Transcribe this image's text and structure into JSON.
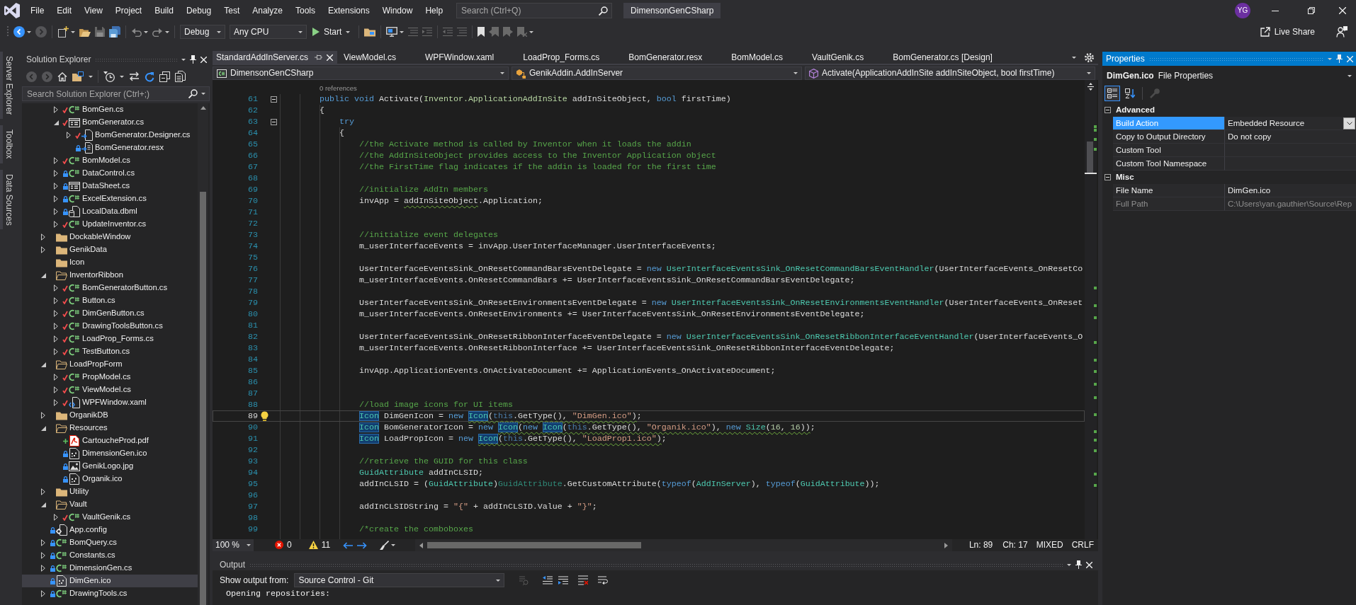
{
  "title_bar": {
    "menu": [
      "File",
      "Edit",
      "View",
      "Project",
      "Build",
      "Debug",
      "Test",
      "Analyze",
      "Tools",
      "Extensions",
      "Window",
      "Help"
    ],
    "search": {
      "placeholder": "Search (Ctrl+Q)"
    },
    "solution_name": "DimensonGenCSharp",
    "user_initials": "YG"
  },
  "toolbar": {
    "configuration": "Debug",
    "platform": "Any CPU",
    "start": "Start",
    "live_share": "Live Share"
  },
  "side_tabs": [
    "Server Explorer",
    "Toolbox",
    "Data Sources"
  ],
  "solution_explorer": {
    "title": "Solution Explorer",
    "search": {
      "placeholder": "Search Solution Explorer (Ctrl+;)"
    },
    "items": [
      {
        "children": [
          {
            "label": "BomGen.cs",
            "kind": "csharp",
            "checked_out": true,
            "locked": false,
            "added": false,
            "expanded": false,
            "selected": false
          },
          {
            "label": "BomGenerator.cs",
            "kind": "form",
            "checked_out": true,
            "locked": false,
            "added": false,
            "expanded": true,
            "selected": false,
            "children": [
              {
                "label": "BomGenerator.Designer.cs",
                "kind": "designer",
                "checked_out": true,
                "locked": false,
                "added": false,
                "expanded": false,
                "selected": false
              },
              {
                "label": "BomGenerator.resx",
                "kind": "resource",
                "checked_out": false,
                "locked": true,
                "added": false,
                "selected": false
              }
            ]
          },
          {
            "label": "BomModel.cs",
            "kind": "csharp",
            "checked_out": true,
            "locked": false,
            "added": false,
            "expanded": false,
            "selected": false
          },
          {
            "label": "DataControl.cs",
            "kind": "csharp",
            "checked_out": false,
            "locked": true,
            "added": false,
            "expanded": false,
            "selected": false
          },
          {
            "label": "DataSheet.cs",
            "kind": "form",
            "checked_out": false,
            "locked": true,
            "added": false,
            "expanded": false,
            "selected": false
          },
          {
            "label": "ExcelExtension.cs",
            "kind": "csharp",
            "checked_out": false,
            "locked": true,
            "added": false,
            "expanded": false,
            "selected": false
          },
          {
            "label": "LocalData.dbml",
            "kind": "database",
            "checked_out": false,
            "locked": true,
            "added": false,
            "expanded": false,
            "selected": false
          },
          {
            "label": "UpdateInventor.cs",
            "kind": "csharp",
            "checked_out": true,
            "locked": false,
            "added": false,
            "expanded": false,
            "selected": false
          }
        ]
      },
      {
        "label": "DockableWindow",
        "kind": "folder",
        "expanded": false,
        "selected": false
      },
      {
        "label": "GenikData",
        "kind": "folder",
        "expanded": false,
        "selected": false
      },
      {
        "label": "Icon",
        "kind": "folder",
        "selected": false
      },
      {
        "label": "InventorRibbon",
        "kind": "folder",
        "expanded": true,
        "selected": false,
        "children": [
          {
            "label": "BomGeneratorButton.cs",
            "kind": "csharp",
            "checked_out": true,
            "locked": false,
            "added": false,
            "expanded": false,
            "selected": false
          },
          {
            "label": "Button.cs",
            "kind": "csharp",
            "checked_out": true,
            "locked": false,
            "added": false,
            "expanded": false,
            "selected": false
          },
          {
            "label": "DimGenButton.cs",
            "kind": "csharp",
            "checked_out": true,
            "locked": false,
            "added": false,
            "expanded": false,
            "selected": false
          },
          {
            "label": "DrawingToolsButton.cs",
            "kind": "csharp",
            "checked_out": true,
            "locked": false,
            "added": false,
            "expanded": false,
            "selected": false
          },
          {
            "label": "LoadProp_Forms.cs",
            "kind": "csharp",
            "checked_out": true,
            "locked": false,
            "added": false,
            "expanded": false,
            "selected": false
          },
          {
            "label": "TestButton.cs",
            "kind": "csharp",
            "checked_out": true,
            "locked": false,
            "added": false,
            "expanded": false,
            "selected": false
          }
        ]
      },
      {
        "label": "LoadPropForm",
        "kind": "folder",
        "expanded": true,
        "selected": false,
        "children": [
          {
            "label": "PropModel.cs",
            "kind": "csharp",
            "checked_out": true,
            "locked": false,
            "added": false,
            "expanded": false,
            "selected": false
          },
          {
            "label": "ViewModel.cs",
            "kind": "csharp",
            "checked_out": true,
            "locked": false,
            "added": false,
            "expanded": false,
            "selected": false
          },
          {
            "label": "WPFWindow.xaml",
            "kind": "xaml",
            "checked_out": true,
            "locked": false,
            "added": false,
            "expanded": false,
            "selected": false
          }
        ]
      },
      {
        "label": "OrganikDB",
        "kind": "folder",
        "expanded": false,
        "selected": false
      },
      {
        "label": "Resources",
        "kind": "folder",
        "expanded": true,
        "selected": false,
        "children": [
          {
            "label": "CartoucheProd.pdf",
            "kind": "pdf",
            "checked_out": false,
            "locked": false,
            "added": true,
            "selected": false
          },
          {
            "label": "DimensionGen.ico",
            "kind": "icon-file",
            "checked_out": false,
            "locked": true,
            "added": false,
            "selected": false
          },
          {
            "label": "GenikLogo.jpg",
            "kind": "image",
            "checked_out": false,
            "locked": true,
            "added": false,
            "selected": false
          },
          {
            "label": "Organik.ico",
            "kind": "icon-file",
            "checked_out": false,
            "locked": true,
            "added": false,
            "selected": false
          }
        ]
      },
      {
        "label": "Utility",
        "kind": "folder",
        "expanded": false,
        "selected": false
      },
      {
        "label": "Vault",
        "kind": "folder",
        "expanded": true,
        "selected": false,
        "children": [
          {
            "label": "VaultGenik.cs",
            "kind": "csharp",
            "checked_out": true,
            "locked": false,
            "added": false,
            "expanded": false,
            "selected": false
          }
        ]
      },
      {
        "label": "App.config",
        "kind": "config",
        "checked_out": false,
        "locked": true,
        "added": false,
        "selected": false
      },
      {
        "label": "BomQuery.cs",
        "kind": "csharp",
        "checked_out": false,
        "locked": true,
        "added": false,
        "expanded": false,
        "selected": false
      },
      {
        "label": "Constants.cs",
        "kind": "csharp",
        "checked_out": false,
        "locked": true,
        "added": false,
        "expanded": false,
        "selected": false
      },
      {
        "label": "DimensionGen.cs",
        "kind": "csharp",
        "checked_out": false,
        "locked": true,
        "added": false,
        "expanded": false,
        "selected": false
      },
      {
        "label": "DimGen.ico",
        "kind": "icon-file",
        "checked_out": false,
        "locked": true,
        "added": false,
        "selected": true
      },
      {
        "label": "DrawingTools.cs",
        "kind": "csharp",
        "checked_out": false,
        "locked": true,
        "added": false,
        "expanded": false,
        "selected": false
      }
    ]
  },
  "editor": {
    "tabs": [
      {
        "label": "StandardAddInServer.cs",
        "selected": true
      },
      {
        "label": "ViewModel.cs",
        "selected": false
      },
      {
        "label": "WPFWindow.xaml",
        "selected": false
      },
      {
        "label": "LoadProp_Forms.cs",
        "selected": false
      },
      {
        "label": "BomGenerator.resx",
        "selected": false
      },
      {
        "label": "BomModel.cs",
        "selected": false
      },
      {
        "label": "VaultGenik.cs",
        "selected": false
      },
      {
        "label": "BomGenerator.cs [Design]",
        "selected": false
      }
    ],
    "navigation": [
      {
        "kind": "project",
        "label": "DimensonGenCSharp"
      },
      {
        "kind": "class",
        "label": "GenikAddin.AddInServer"
      },
      {
        "kind": "method",
        "label": "Activate(ApplicationAddInSite addInSiteObject, bool firstTime)"
      }
    ],
    "lines": [
      {
        "number": "61",
        "codelens": "0 references",
        "folded": false,
        "tokens": [
          {
            "text": "        public void",
            "kind": "keyword"
          },
          {
            "text": " Activate(",
            "kind": "plain"
          },
          {
            "text": "Inventor.ApplicationAddInSite",
            "kind": "interface"
          },
          {
            "text": " addInSiteObject, ",
            "kind": "plain"
          },
          {
            "text": "bool",
            "kind": "keyword"
          },
          {
            "text": " firstTime)",
            "kind": "plain"
          }
        ]
      },
      {
        "number": "62",
        "tokens": [
          {
            "text": "        {",
            "kind": "plain"
          }
        ]
      },
      {
        "number": "63",
        "folded": false,
        "tokens": [
          {
            "text": "            try",
            "kind": "keyword"
          }
        ]
      },
      {
        "number": "64",
        "tokens": [
          {
            "text": "            {",
            "kind": "plain"
          }
        ]
      },
      {
        "number": "65",
        "tokens": [
          {
            "text": "                //the Activate method is called by Inventor when it loads the addin",
            "kind": "comment"
          }
        ]
      },
      {
        "number": "66",
        "tokens": [
          {
            "text": "                //the AddInSiteObject provides access to the Inventor Application object",
            "kind": "comment"
          }
        ]
      },
      {
        "number": "67",
        "tokens": [
          {
            "text": "                //the FirstTime flag indicates if the addin is loaded for the first time",
            "kind": "comment"
          }
        ]
      },
      {
        "number": "68"
      },
      {
        "number": "69",
        "tokens": [
          {
            "text": "                //initialize AddIn members",
            "kind": "comment"
          }
        ]
      },
      {
        "number": "70",
        "tokens": [
          {
            "text": "                invApp = ",
            "kind": "plain"
          },
          {
            "text": "addInSiteObject",
            "kind": "plain",
            "squiggle": true
          },
          {
            "text": ".Application;",
            "kind": "plain"
          }
        ]
      },
      {
        "number": "71"
      },
      {
        "number": "72"
      },
      {
        "number": "73",
        "tokens": [
          {
            "text": "                //initialize event delegates",
            "kind": "comment"
          }
        ]
      },
      {
        "number": "74",
        "tokens": [
          {
            "text": "                m_userInterfaceEvents = invApp.UserInterfaceManager.UserInterfaceEvents;",
            "kind": "plain"
          }
        ]
      },
      {
        "number": "75"
      },
      {
        "number": "76",
        "tokens": [
          {
            "text": "                UserInterfaceEventsSink_OnResetCommandBarsEventDelegate = ",
            "kind": "plain"
          },
          {
            "text": "new",
            "kind": "keyword"
          },
          {
            "text": " UserInterfaceEventsSink_OnResetCommandBarsEventHandler",
            "kind": "type"
          },
          {
            "text": "(UserInterfaceEvents_OnResetCo",
            "kind": "plain"
          }
        ]
      },
      {
        "number": "77",
        "tokens": [
          {
            "text": "                m_userInterfaceEvents.OnResetCommandBars += UserInterfaceEventsSink_OnResetCommandBarsEventDelegate;",
            "kind": "plain"
          }
        ]
      },
      {
        "number": "78"
      },
      {
        "number": "79",
        "tokens": [
          {
            "text": "                UserInterfaceEventsSink_OnResetEnvironmentsEventDelegate = ",
            "kind": "plain"
          },
          {
            "text": "new",
            "kind": "keyword"
          },
          {
            "text": " UserInterfaceEventsSink_OnResetEnvironmentsEventHandler",
            "kind": "type"
          },
          {
            "text": "(UserInterfaceEvents_OnReset",
            "kind": "plain"
          }
        ]
      },
      {
        "number": "80",
        "tokens": [
          {
            "text": "                m_userInterfaceEvents.OnResetEnvironments += UserInterfaceEventsSink_OnResetEnvironmentsEventDelegate;",
            "kind": "plain"
          }
        ]
      },
      {
        "number": "81"
      },
      {
        "number": "82",
        "tokens": [
          {
            "text": "                UserInterfaceEventsSink_OnResetRibbonInterfaceEventDelegate = ",
            "kind": "plain"
          },
          {
            "text": "new",
            "kind": "keyword"
          },
          {
            "text": " UserInterfaceEventsSink_OnResetRibbonInterfaceEventHandler",
            "kind": "type"
          },
          {
            "text": "(UserInterfaceEvents_O",
            "kind": "plain"
          }
        ]
      },
      {
        "number": "83",
        "tokens": [
          {
            "text": "                m_userInterfaceEvents.OnResetRibbonInterface += UserInterfaceEventsSink_OnResetRibbonInterfaceEventDelegate;",
            "kind": "plain"
          }
        ]
      },
      {
        "number": "84"
      },
      {
        "number": "85",
        "tokens": [
          {
            "text": "                invApp.ApplicationEvents.OnActivateDocument += ApplicationEvents_OnActivateDocument;",
            "kind": "plain"
          }
        ]
      },
      {
        "number": "86"
      },
      {
        "number": "87"
      },
      {
        "number": "88",
        "tokens": [
          {
            "text": "                //load image icons for UI items",
            "kind": "comment"
          }
        ]
      },
      {
        "number": "89",
        "current": true,
        "lightbulb": true,
        "tokens": [
          {
            "text": "                Icon",
            "kind": "type",
            "highlight": true
          },
          {
            "text": " DimGenIcon = ",
            "kind": "plain"
          },
          {
            "text": "new ",
            "kind": "keyword"
          },
          {
            "text": "Icon",
            "kind": "type",
            "highlight": true,
            "squiggle": true
          },
          {
            "text": "(",
            "kind": "plain",
            "squiggle": true
          },
          {
            "text": "this",
            "kind": "faded_keyword",
            "squiggle": true
          },
          {
            "text": ".GetType(), ",
            "kind": "plain",
            "squiggle": true
          },
          {
            "text": "\"DimGen.ico\"",
            "kind": "string",
            "squiggle": true
          },
          {
            "text": ")",
            "kind": "plain",
            "squiggle": true
          },
          {
            "text": ";",
            "kind": "plain"
          }
        ]
      },
      {
        "number": "90",
        "tokens": [
          {
            "text": "                Icon",
            "kind": "type",
            "highlight": true
          },
          {
            "text": " BomGeneratorIcon = ",
            "kind": "plain"
          },
          {
            "text": "new ",
            "kind": "keyword"
          },
          {
            "text": "Icon",
            "kind": "type",
            "highlight": true,
            "squiggle": true
          },
          {
            "text": "(",
            "kind": "plain",
            "squiggle": true
          },
          {
            "text": "new ",
            "kind": "keyword",
            "squiggle": true
          },
          {
            "text": "Icon",
            "kind": "type",
            "highlight": true,
            "squiggle": true
          },
          {
            "text": "(",
            "kind": "plain",
            "squiggle": true
          },
          {
            "text": "this",
            "kind": "faded_keyword",
            "squiggle": true
          },
          {
            "text": ".GetType(), ",
            "kind": "plain",
            "squiggle": true
          },
          {
            "text": "\"Organik.ico\"",
            "kind": "string",
            "squiggle": true
          },
          {
            "text": "), ",
            "kind": "plain",
            "squiggle": true
          },
          {
            "text": "new ",
            "kind": "keyword",
            "squiggle": true
          },
          {
            "text": "Size",
            "kind": "type",
            "squiggle": true
          },
          {
            "text": "(",
            "kind": "plain",
            "squiggle": true
          },
          {
            "text": "16",
            "kind": "number",
            "squiggle": true
          },
          {
            "text": ", ",
            "kind": "plain",
            "squiggle": true
          },
          {
            "text": "16",
            "kind": "number",
            "squiggle": true
          },
          {
            "text": "))",
            "kind": "plain",
            "squiggle": true
          },
          {
            "text": ";",
            "kind": "plain"
          }
        ]
      },
      {
        "number": "91",
        "tokens": [
          {
            "text": "                Icon",
            "kind": "type",
            "highlight": true
          },
          {
            "text": " LoadPropIcon = ",
            "kind": "plain"
          },
          {
            "text": "new ",
            "kind": "keyword"
          },
          {
            "text": "Icon",
            "kind": "type",
            "highlight": true,
            "squiggle": true
          },
          {
            "text": "(",
            "kind": "plain",
            "squiggle": true
          },
          {
            "text": "this",
            "kind": "faded_keyword",
            "squiggle": true
          },
          {
            "text": ".GetType(), ",
            "kind": "plain",
            "squiggle": true
          },
          {
            "text": "\"LoadProp1.ico\"",
            "kind": "string",
            "squiggle": true
          },
          {
            "text": ")",
            "kind": "plain",
            "squiggle": true
          },
          {
            "text": ";",
            "kind": "plain"
          }
        ]
      },
      {
        "number": "92"
      },
      {
        "number": "93",
        "tokens": [
          {
            "text": "                //retrieve the GUID for this class",
            "kind": "comment"
          }
        ]
      },
      {
        "number": "94",
        "tokens": [
          {
            "text": "                GuidAttribute",
            "kind": "type"
          },
          {
            "text": " addInCLSID;",
            "kind": "plain"
          }
        ]
      },
      {
        "number": "95",
        "tokens": [
          {
            "text": "                addInCLSID = (",
            "kind": "plain"
          },
          {
            "text": "GuidAttribute",
            "kind": "type"
          },
          {
            "text": ")",
            "kind": "plain"
          },
          {
            "text": "GuidAttribute",
            "kind": "faded_type"
          },
          {
            "text": ".GetCustomAttribute(",
            "kind": "plain"
          },
          {
            "text": "typeof",
            "kind": "keyword"
          },
          {
            "text": "(",
            "kind": "plain"
          },
          {
            "text": "AddInServer",
            "kind": "type"
          },
          {
            "text": "), ",
            "kind": "plain"
          },
          {
            "text": "typeof",
            "kind": "keyword"
          },
          {
            "text": "(",
            "kind": "plain"
          },
          {
            "text": "GuidAttribute",
            "kind": "type"
          },
          {
            "text": "));",
            "kind": "plain"
          }
        ]
      },
      {
        "number": "96"
      },
      {
        "number": "97",
        "tokens": [
          {
            "text": "                addInCLSIDString = ",
            "kind": "plain"
          },
          {
            "text": "\"{\"",
            "kind": "string"
          },
          {
            "text": " + addInCLSID.Value + ",
            "kind": "plain"
          },
          {
            "text": "\"}\"",
            "kind": "string"
          },
          {
            "text": ";",
            "kind": "plain"
          }
        ]
      },
      {
        "number": "98"
      },
      {
        "number": "99",
        "tokens": [
          {
            "text": "                /*create the comboboxes",
            "kind": "comment"
          }
        ]
      }
    ],
    "status_bar": {
      "zoom": "100 %",
      "errors": "0",
      "warnings": "11",
      "line": "Ln: 89",
      "column": "Ch: 17",
      "encoding": "MIXED",
      "line_endings": "CRLF"
    }
  },
  "output": {
    "title": "Output",
    "source_label": "Show output from:",
    "source": "Source Control - Git",
    "lines": [
      "Opening repositories:"
    ]
  },
  "properties": {
    "title": "Properties",
    "object_name": "DimGen.ico",
    "object_type": "File Properties",
    "view_buttons": [
      {
        "kind": "categorized",
        "selected": true,
        "disabled": false
      },
      {
        "kind": "alphabetical",
        "selected": false,
        "disabled": false
      },
      {
        "kind": "property-pages",
        "selected": false,
        "disabled": true
      }
    ],
    "categories": [
      {
        "name": "Advanced",
        "expanded": true,
        "rows": [
          {
            "name": "Build Action",
            "value": "Embedded Resource",
            "selected": true,
            "disabled": false,
            "dropdown": true
          },
          {
            "name": "Copy to Output Directory",
            "value": "Do not copy",
            "selected": false,
            "disabled": false
          },
          {
            "name": "Custom Tool",
            "selected": false,
            "disabled": false
          },
          {
            "name": "Custom Tool Namespace",
            "selected": false,
            "disabled": false
          }
        ]
      },
      {
        "name": "Misc",
        "expanded": true,
        "rows": [
          {
            "name": "File Name",
            "value": "DimGen.ico",
            "selected": false,
            "disabled": false
          },
          {
            "name": "Full Path",
            "value": "C:\\Users\\yan.gauthier\\Source\\Rep",
            "selected": false,
            "disabled": true
          }
        ]
      }
    ]
  }
}
